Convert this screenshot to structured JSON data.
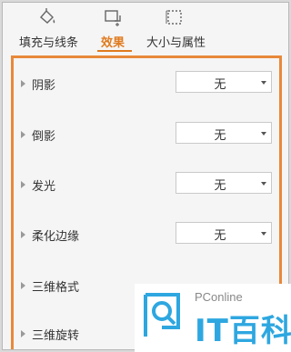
{
  "tabs": [
    {
      "label": "填充与线条",
      "icon": "fill-bucket-icon",
      "active": false
    },
    {
      "label": "效果",
      "icon": "effects-icon",
      "active": true
    },
    {
      "label": "大小与属性",
      "icon": "size-properties-icon",
      "active": false
    }
  ],
  "colors": {
    "accent": "#e07b1f",
    "highlight_border": "#e8893a",
    "watermark_blue": "#2ea7e0"
  },
  "effects": {
    "shadow": {
      "label": "阴影",
      "value": "无"
    },
    "reflection": {
      "label": "倒影",
      "value": "无"
    },
    "glow": {
      "label": "发光",
      "value": "无"
    },
    "soft_edges": {
      "label": "柔化边缘",
      "value": "无"
    },
    "format_3d": {
      "label": "三维格式"
    },
    "rotation_3d": {
      "label": "三维旋转"
    }
  },
  "watermark": {
    "brand": "PConline",
    "name": "IT百科"
  }
}
